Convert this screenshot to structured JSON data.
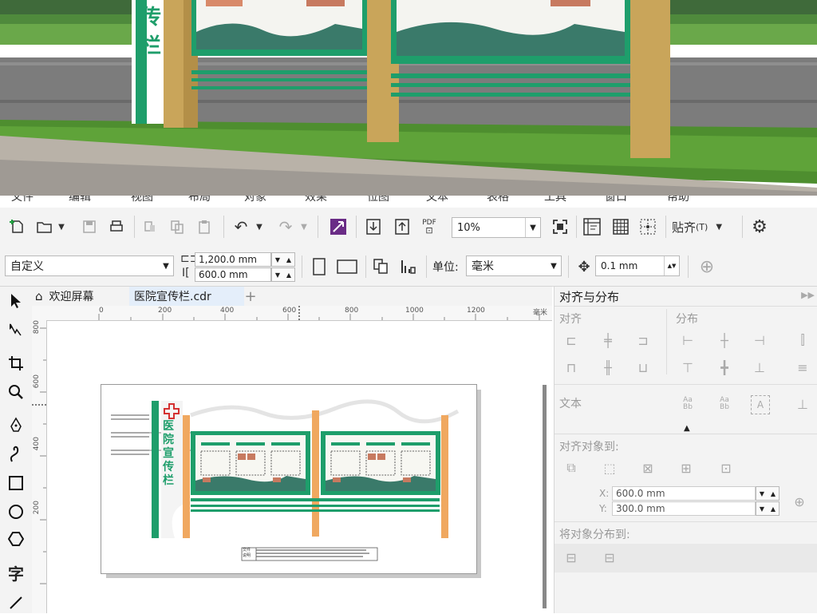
{
  "photo": {
    "sign_vertical_text": "传栏"
  },
  "menubar": {
    "items": [
      "文件",
      "编辑",
      "视图",
      "布局",
      "对象",
      "效果",
      "位图",
      "文本",
      "表格",
      "工具",
      "窗口",
      "帮助"
    ]
  },
  "toolbar": {
    "zoom_value": "10%",
    "snap_label": "贴齐",
    "snap_suffix": "(T)",
    "pdf_label": "PDF"
  },
  "property_bar": {
    "preset": "自定义",
    "width": "1,200.0 mm",
    "height": "600.0 mm",
    "unit_label": "单位:",
    "unit_value": "毫米",
    "nudge": "0.1 mm"
  },
  "toolbox": {
    "icons": [
      "pick-tool-icon",
      "shape-tool-icon",
      "crop-tool-icon",
      "zoom-tool-icon",
      "pen-tool-icon",
      "curve-tool-icon",
      "rectangle-tool-icon",
      "ellipse-tool-icon",
      "polygon-tool-icon",
      "text-tool-icon",
      "line-tool-icon"
    ],
    "text_tool_glyph": "字"
  },
  "tabs": {
    "welcome": "欢迎屏幕",
    "document": "医院宣传栏.cdr",
    "add": "+"
  },
  "rulers": {
    "h_ticks": [
      "0",
      "200",
      "400",
      "600",
      "800",
      "1000",
      "1200"
    ],
    "v_ticks": [
      "800",
      "600",
      "400",
      "200"
    ],
    "corner": "毫米"
  },
  "drawing": {
    "sign_title": "医院宣传栏",
    "footer_label_1": "文件",
    "footer_label_2": "说明"
  },
  "docker": {
    "title": "对齐与分布",
    "align_label": "对齐",
    "distribute_label": "分布",
    "text_label": "文本",
    "align_to_label": "对齐对象到:",
    "x_label": "X:",
    "x_value": "600.0 mm",
    "y_label": "Y:",
    "y_value": "300.0 mm",
    "distribute_to_label": "将对象分布到:",
    "text_icon_1": "Aa\nBb",
    "text_icon_2": "Aa\nBb"
  },
  "colors": {
    "green": "#1e9e6b",
    "orange": "#f0a860",
    "tan": "#c9a55a"
  }
}
